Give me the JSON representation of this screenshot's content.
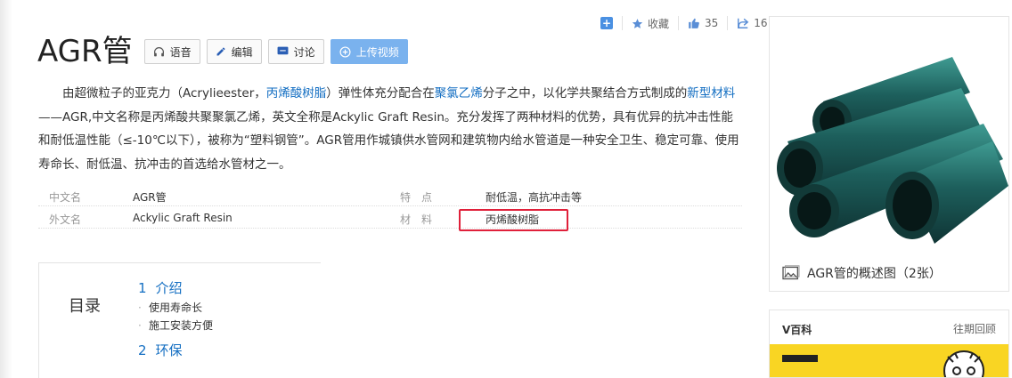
{
  "stats": {
    "collect_label": "收藏",
    "like_count": "35",
    "share_count": "16"
  },
  "title": "AGR管",
  "buttons": {
    "voice": "语音",
    "edit": "编辑",
    "discuss": "讨论",
    "upload_video": "上传视频"
  },
  "summary": {
    "p1": "由超微粒子的亚克力（Acrylieester，",
    "link1": "丙烯酸树脂",
    "p2": "）弹性体充分配合在",
    "link2": "聚氯乙烯",
    "p3": "分子之中，以化学共聚结合方式制成的",
    "link3": "新型材料",
    "p4": "——AGR,中文名称是丙烯酸共聚聚氯乙烯，英文全称是Ackylic Graft Resin。充分发挥了两种材料的优势，具有优异的抗冲击性能和耐低温性能（≤-10℃以下），被称为“塑料钢管”。AGR管用作城镇供水管网和建筑物内给水管道是一种安全卫生、稳定可靠、使用寿命长、耐低温、抗冲击的首选给水管材之一。"
  },
  "info": {
    "rows": [
      {
        "label1": "中文名",
        "value1": "AGR管",
        "label2": "特　点",
        "value2": "耐低温，高抗冲击等"
      },
      {
        "label1": "外文名",
        "value1": "Ackylic Graft Resin",
        "label2": "材　料",
        "value2": "丙烯酸树脂"
      }
    ]
  },
  "toc": {
    "title": "目录",
    "items": [
      {
        "num": "1",
        "label": "介绍",
        "subs": [
          "使用寿命长",
          "施工安装方便"
        ]
      },
      {
        "num": "2",
        "label": "环保"
      }
    ]
  },
  "album": {
    "caption": "AGR管的概述图（2张）"
  },
  "vcard": {
    "title": "V百科",
    "more": "往期回顾"
  },
  "colors": {
    "link": "#136ec2",
    "primary_button": "#7ab2ee",
    "highlight_box": "#e0203a",
    "pipe": "#1f6b68",
    "banner": "#f9d523"
  }
}
